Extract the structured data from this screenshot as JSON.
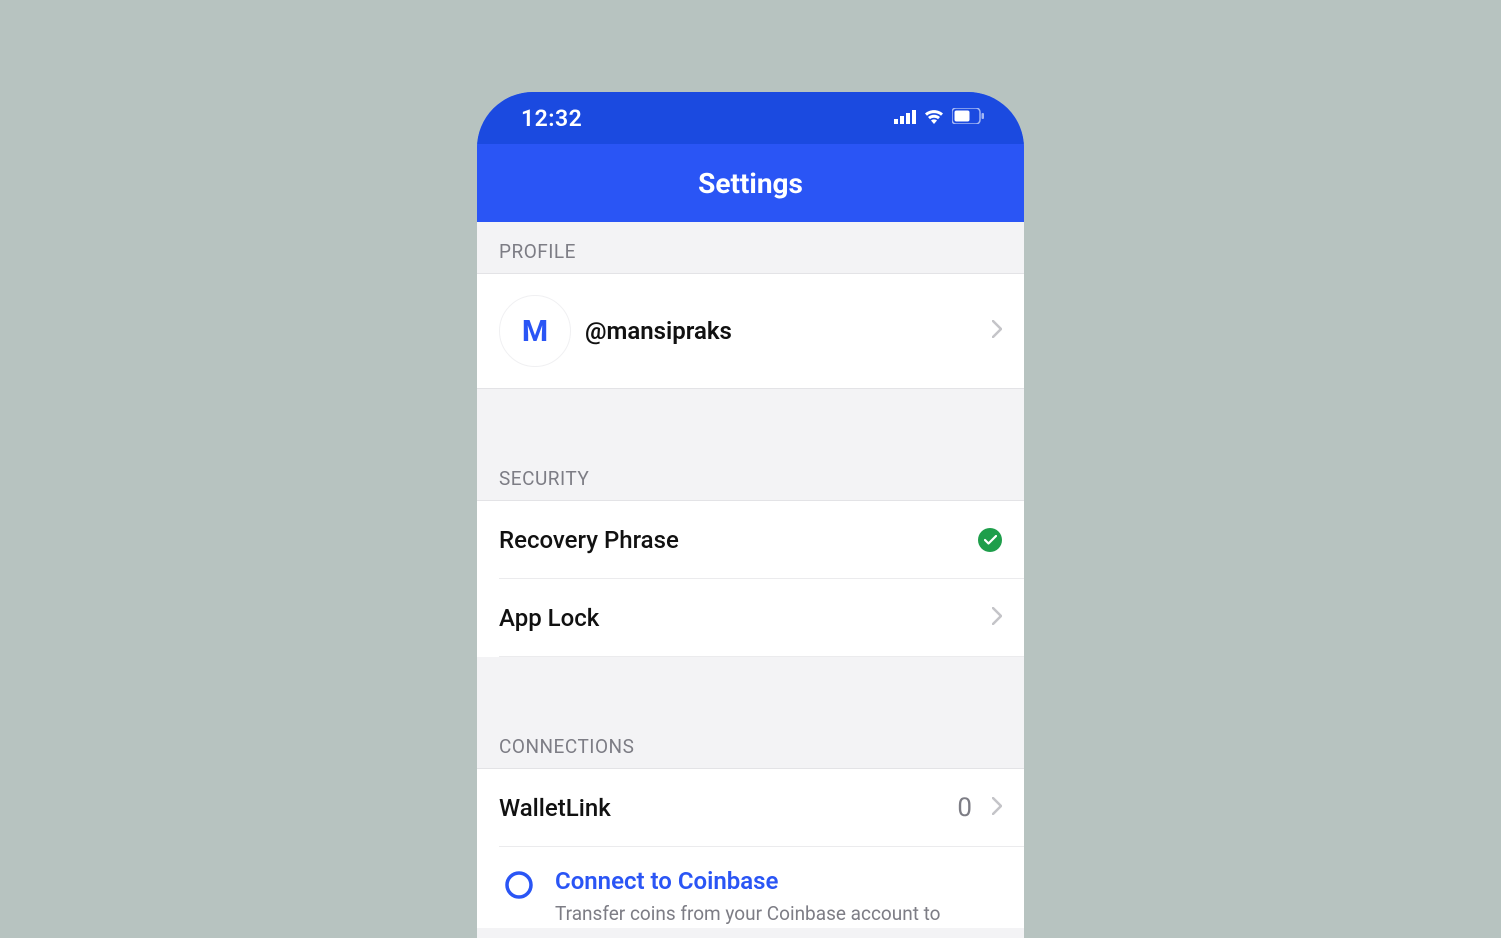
{
  "statusBar": {
    "time": "12:32"
  },
  "nav": {
    "title": "Settings"
  },
  "sections": {
    "profile": {
      "header": "PROFILE",
      "avatarLetter": "M",
      "username": "@mansipraks"
    },
    "security": {
      "header": "SECURITY",
      "recovery": "Recovery Phrase",
      "appLock": "App Lock"
    },
    "connections": {
      "header": "CONNECTIONS",
      "walletLink": {
        "label": "WalletLink",
        "value": "0"
      },
      "connect": {
        "title": "Connect to Coinbase",
        "subtitle": "Transfer coins from your Coinbase account to"
      }
    }
  }
}
